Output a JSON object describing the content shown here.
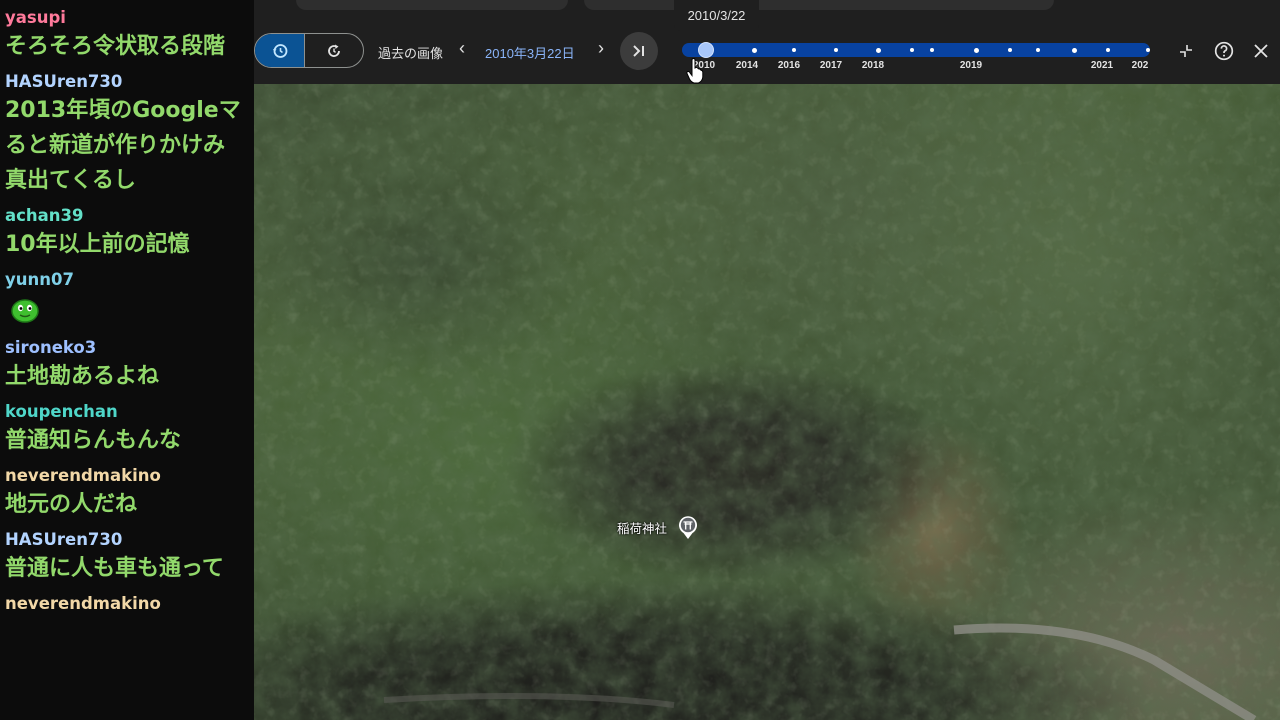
{
  "chat": {
    "messages": [
      {
        "user": "yasupi",
        "user_color": "#ff7a9b",
        "text": "そろそろ令状取る段階"
      },
      {
        "user": "HASUren730",
        "user_color": "#b3d4ff",
        "text": "2013年頃のGoogleマ\nると新道が作りかけみ\n真出てくるし"
      },
      {
        "user": "achan39",
        "user_color": "#63e0c8",
        "text": "10年以上前の記憶"
      },
      {
        "user": "yunn07",
        "user_color": "#7fd0e8",
        "emoji": "slime-emoji"
      },
      {
        "user": "sironeko3",
        "user_color": "#9ec0ff",
        "text": "土地勘あるよね"
      },
      {
        "user": "koupenchan",
        "user_color": "#4fd6c9",
        "text": "普通知らんもんな"
      },
      {
        "user": "neverendmakino",
        "user_color": "#f2d8a7",
        "text": "地元の人だね"
      },
      {
        "user": "HASUren730",
        "user_color": "#b3d4ff",
        "text": "普通に人も車も通って"
      },
      {
        "user": "neverendmakino",
        "user_color": "#f2d8a7",
        "text": ""
      }
    ]
  },
  "toolbar": {
    "past_imagery_label": "過去の画像",
    "current_date": "2010年3月22日",
    "prev_icon": "chevron-left-icon",
    "next_icon": "chevron-right-icon",
    "jump_icon": "skip-to-latest-icon",
    "history_icon": "history-icon",
    "restore_icon": "refresh-clock-icon",
    "collapse_icon": "collapse-icon",
    "help_icon": "help-icon",
    "close_icon": "close-icon",
    "accent_color": "#0842a0"
  },
  "timeline": {
    "selected_date_tooltip": "2010/3/22",
    "years": [
      "2010",
      "2014",
      "2016",
      "2017",
      "2018",
      "2019",
      "2021",
      "202"
    ]
  },
  "map": {
    "place_label": "稲荷神社",
    "place_icon": "shrine-icon"
  }
}
